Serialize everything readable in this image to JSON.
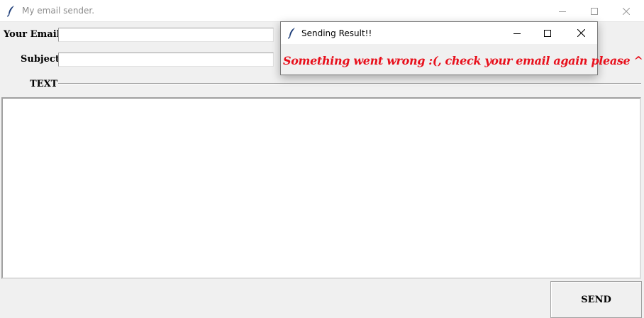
{
  "main_window": {
    "title": "My email sender.",
    "controls": {
      "minimize_icon": "minimize-icon",
      "maximize_icon": "maximize-icon",
      "close_icon": "close-icon"
    }
  },
  "form": {
    "email_label": "Your Email:",
    "email_value": "",
    "subject_label": "Subject:",
    "subject_value": "",
    "text_section_label": "TEXT",
    "body_value": ""
  },
  "actions": {
    "send_label": "SEND"
  },
  "popup": {
    "title": "Sending Result!!",
    "message": "Something went wrong :(, check your email again please ^^",
    "message_color": "#e8101c"
  },
  "icons": {
    "app_icon": "feather-icon"
  }
}
